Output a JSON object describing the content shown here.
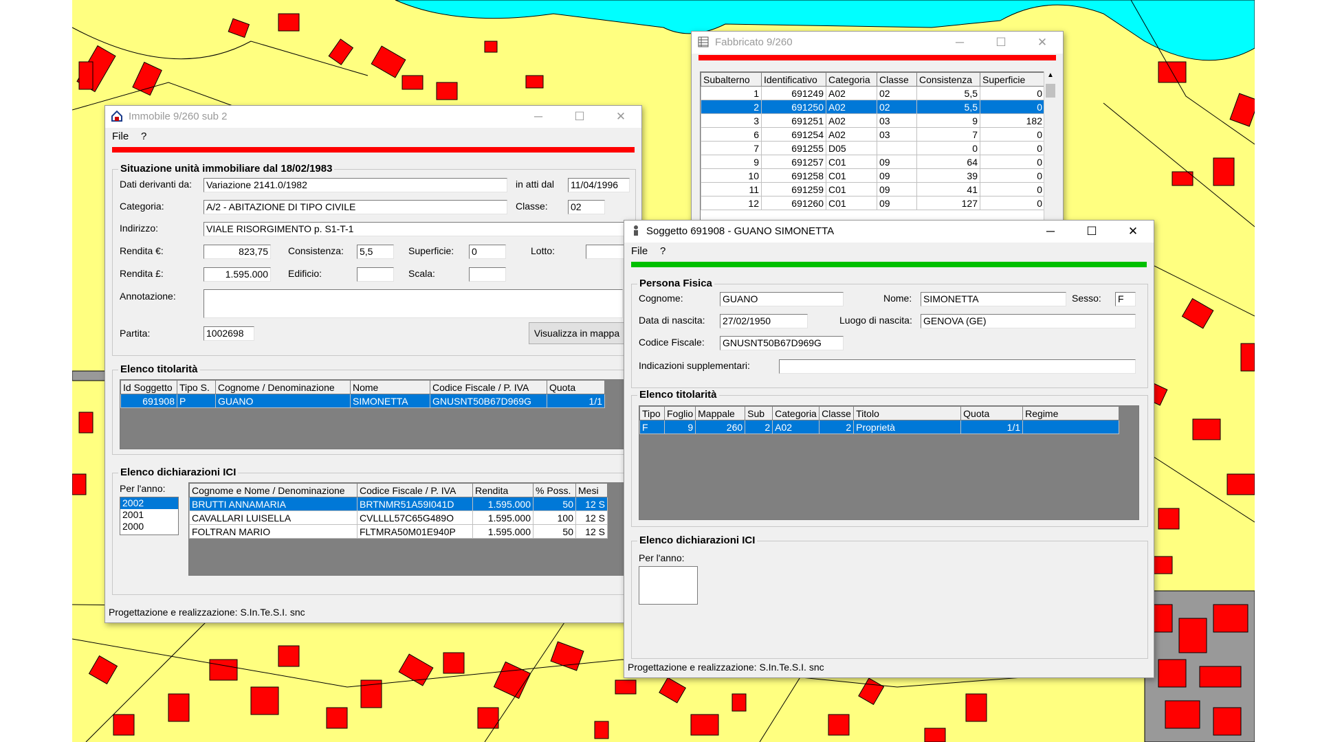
{
  "colors": {
    "map_bg": "#ffff80",
    "water": "#00ffff",
    "building": "#ff0000",
    "bar_red": "#ff0000",
    "bar_green": "#00c000",
    "selection": "#0078d7"
  },
  "fabbricato": {
    "title": "Fabbricato 9/260",
    "icon": "table-icon",
    "columns": [
      "Subalterno",
      "Identificativo",
      "Categoria",
      "Classe",
      "Consistenza",
      "Superficie"
    ],
    "rows": [
      [
        "1",
        "691249",
        "A02",
        "02",
        "5,5",
        "0"
      ],
      [
        "2",
        "691250",
        "A02",
        "02",
        "5,5",
        "0"
      ],
      [
        "3",
        "691251",
        "A02",
        "03",
        "9",
        "182"
      ],
      [
        "6",
        "691254",
        "A02",
        "03",
        "7",
        "0"
      ],
      [
        "7",
        "691255",
        "D05",
        "",
        "0",
        "0"
      ],
      [
        "9",
        "691257",
        "C01",
        "09",
        "64",
        "0"
      ],
      [
        "10",
        "691258",
        "C01",
        "09",
        "39",
        "0"
      ],
      [
        "11",
        "691259",
        "C01",
        "09",
        "41",
        "0"
      ],
      [
        "12",
        "691260",
        "C01",
        "09",
        "127",
        "0"
      ]
    ],
    "selected_row": 1
  },
  "immobile": {
    "title": "Immobile 9/260 sub 2",
    "icon": "house-icon",
    "menu": [
      "File",
      "?"
    ],
    "situazione": {
      "heading": "Situazione unità immobiliare dal 18/02/1983",
      "dati_label": "Dati derivanti da:",
      "dati_value": "Variazione 2141.0/1982",
      "atti_label": "in atti dal",
      "atti_value": "11/04/1996",
      "categoria_label": "Categoria:",
      "categoria_value": "A/2 - ABITAZIONE DI TIPO CIVILE",
      "classe_label": "Classe:",
      "classe_value": "02",
      "indirizzo_label": "Indirizzo:",
      "indirizzo_value": "VIALE RISORGIMENTO p. S1-T-1",
      "rendita_eur_label": "Rendita €:",
      "rendita_eur_value": "823,75",
      "consistenza_label": "Consistenza:",
      "consistenza_value": "5,5",
      "superficie_label": "Superficie:",
      "superficie_value": "0",
      "lotto_label": "Lotto:",
      "lotto_value": "",
      "rendita_lit_label": "Rendita £:",
      "rendita_lit_value": "1.595.000",
      "edificio_label": "Edificio:",
      "edificio_value": "",
      "scala_label": "Scala:",
      "scala_value": "",
      "annotazione_label": "Annotazione:",
      "annotazione_value": "",
      "partita_label": "Partita:",
      "partita_value": "1002698",
      "mappa_button": "Visualizza in mappa"
    },
    "titolarita": {
      "heading": "Elenco titolarità",
      "columns": [
        "Id Soggetto",
        "Tipo S.",
        "Cognome / Denominazione",
        "Nome",
        "Codice Fiscale / P. IVA",
        "Quota"
      ],
      "rows": [
        [
          "691908",
          "P",
          "GUANO",
          "SIMONETTA",
          "GNUSNT50B67D969G",
          "1/1"
        ]
      ]
    },
    "ici": {
      "heading": "Elenco dichiarazioni ICI",
      "per_anno_label": "Per l'anno:",
      "years": [
        "2002",
        "2001",
        "2000"
      ],
      "columns": [
        "Cognome e Nome / Denominazione",
        "Codice Fiscale / P. IVA",
        "Rendita",
        "% Poss.",
        "Mesi"
      ],
      "rows": [
        [
          "BRUTTI ANNAMARIA",
          "BRTNMR51A59I041D",
          "1.595.000",
          "50",
          "12 S"
        ],
        [
          "CAVALLARI LUISELLA",
          "CVLLLL57C65G489O",
          "1.595.000",
          "100",
          "12 S"
        ],
        [
          "FOLTRAN MARIO",
          "FLTMRA50M01E940P",
          "1.595.000",
          "50",
          "12 S"
        ]
      ]
    },
    "status": "Progettazione e realizzazione: S.In.Te.S.I. snc"
  },
  "soggetto": {
    "title": "Soggetto 691908 - GUANO SIMONETTA",
    "icon": "person-icon",
    "menu": [
      "File",
      "?"
    ],
    "persona": {
      "heading": "Persona Fisica",
      "cognome_label": "Cognome:",
      "cognome_value": "GUANO",
      "nome_label": "Nome:",
      "nome_value": "SIMONETTA",
      "sesso_label": "Sesso:",
      "sesso_value": "F",
      "nascita_label": "Data di nascita:",
      "nascita_value": "27/02/1950",
      "luogo_label": "Luogo di nascita:",
      "luogo_value": "GENOVA (GE)",
      "cf_label": "Codice Fiscale:",
      "cf_value": "GNUSNT50B67D969G",
      "indicazioni_label": "Indicazioni supplementari:",
      "indicazioni_value": ""
    },
    "titolarita": {
      "heading": "Elenco titolarità",
      "columns": [
        "Tipo",
        "Foglio",
        "Mappale",
        "Sub",
        "Categoria",
        "Classe",
        "Titolo",
        "Quota",
        "Regime"
      ],
      "rows": [
        [
          "F",
          "9",
          "260",
          "2",
          "A02",
          "2",
          "Proprietà",
          "1/1",
          ""
        ]
      ]
    },
    "ici": {
      "heading": "Elenco dichiarazioni ICI",
      "per_anno_label": "Per l'anno:"
    },
    "status": "Progettazione e realizzazione: S.In.Te.S.I. snc"
  },
  "window_controls": {
    "minimize": "─",
    "maximize": "☐",
    "close": "✕"
  }
}
